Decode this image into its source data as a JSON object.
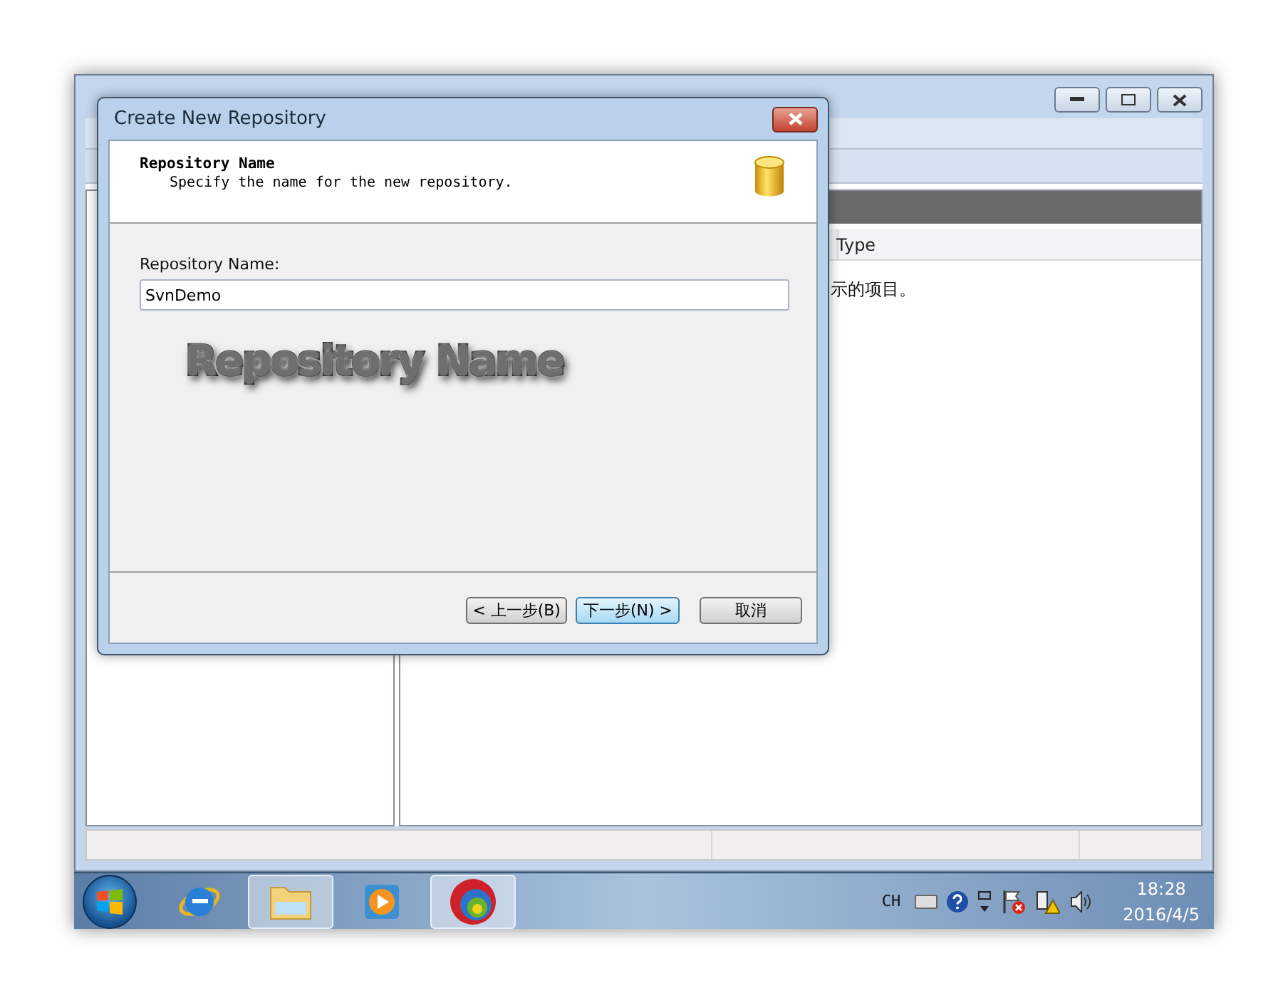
{
  "main_window": {
    "columns": [
      "Type"
    ],
    "list_text": "示的项目。"
  },
  "dialog": {
    "title": "Create New Repository",
    "header_title": "Repository Name",
    "header_subtitle": "Specify the name for the new repository.",
    "field_label": "Repository Name:",
    "field_value": "SvnDemo",
    "caption": "Repository Name",
    "buttons": [
      {
        "label": "< 上一步(B)",
        "focused": false
      },
      {
        "label": "下一步(N) >",
        "focused": true
      },
      {
        "label": "取消",
        "focused": false
      }
    ]
  },
  "taskbar": {
    "apps": [
      {
        "kind": "browser",
        "active": false
      },
      {
        "kind": "folder",
        "active": true
      },
      {
        "kind": "media",
        "active": false
      },
      {
        "kind": "svn",
        "active": true
      }
    ],
    "language": "CH",
    "time": "18:28",
    "date": "2016/4/5"
  }
}
